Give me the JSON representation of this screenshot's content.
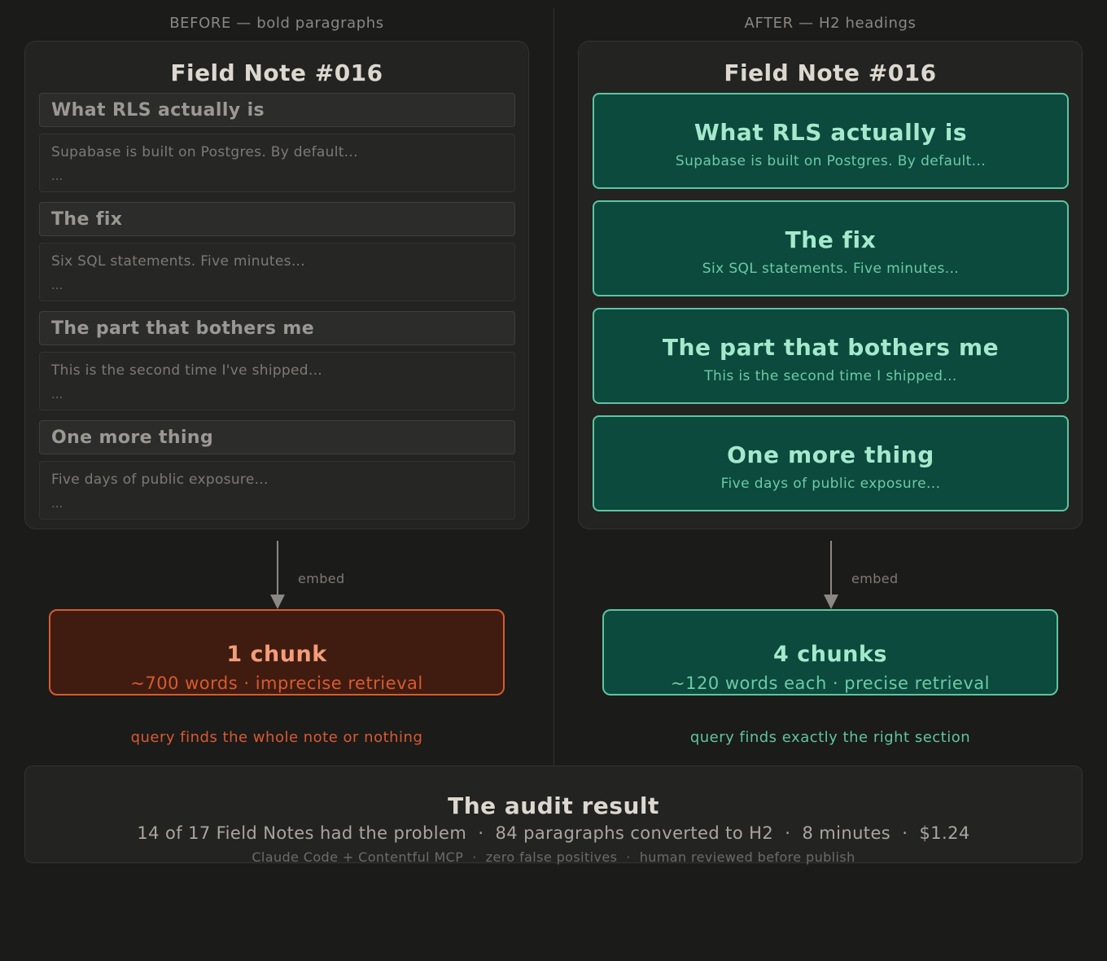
{
  "before": {
    "label": "BEFORE — bold paragraphs",
    "title": "Field Note #016",
    "sections": [
      {
        "heading": "What RLS actually is",
        "body": "Supabase is built on Postgres. By default...",
        "ellipsis": "..."
      },
      {
        "heading": "The fix",
        "body": "Six SQL statements. Five minutes...",
        "ellipsis": "..."
      },
      {
        "heading": "The part that bothers me",
        "body": "This is the second time I've shipped...",
        "ellipsis": "..."
      },
      {
        "heading": "One more thing",
        "body": "Five days of public exposure...",
        "ellipsis": "..."
      }
    ],
    "arrow_label": "embed",
    "result_title": "1 chunk",
    "result_sub": "~700 words · imprecise retrieval",
    "caption": "query finds the whole note or nothing"
  },
  "after": {
    "label": "AFTER — H2 headings",
    "title": "Field Note #016",
    "sections": [
      {
        "heading": "What RLS actually is",
        "body": "Supabase is built on Postgres. By default..."
      },
      {
        "heading": "The fix",
        "body": "Six SQL statements. Five minutes..."
      },
      {
        "heading": "The part that bothers me",
        "body": "This is the second time I shipped..."
      },
      {
        "heading": "One more thing",
        "body": "Five days of public exposure..."
      }
    ],
    "arrow_label": "embed",
    "result_title": "4 chunks",
    "result_sub": "~120 words each · precise retrieval",
    "caption": "query finds exactly the right section"
  },
  "audit": {
    "title": "The audit result",
    "summary": "14 of 17 Field Notes had the problem  ·  84 paragraphs converted to H2  ·  8 minutes  ·  $1.24",
    "footnote": "Claude Code + Contentful MCP  ·  zero false positives  ·  human reviewed before publish"
  },
  "colors": {
    "background": "#1b1b1a",
    "bad_accent": "#d85a30",
    "good_accent": "#5fc4a0",
    "good_fill": "#0b4a3d",
    "bad_fill": "#401c10"
  }
}
